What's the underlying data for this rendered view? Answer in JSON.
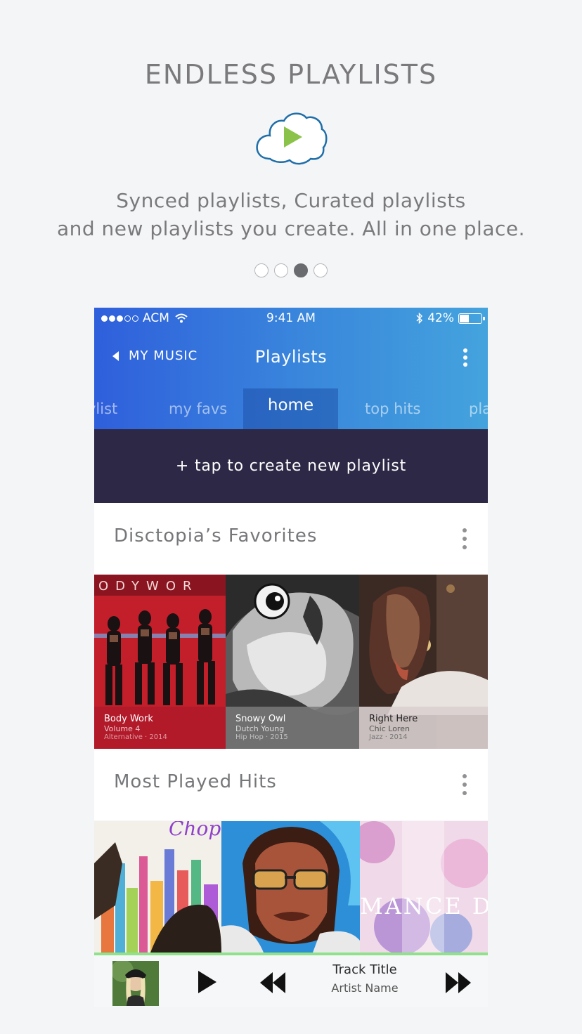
{
  "promo": {
    "title": "ENDLESS PLAYLISTS",
    "line1": "Synced playlists, Curated playlists",
    "line2": "and new playlists you create. All in one place.",
    "icon": "cloud-play-icon",
    "pagination": {
      "count": 4,
      "active_index": 3
    }
  },
  "status_bar": {
    "carrier": "ACM",
    "time": "9:41 AM",
    "battery": "42%",
    "battery_level": 0.42
  },
  "nav": {
    "back_label": "MY MUSIC",
    "title": "Playlists"
  },
  "tabs": [
    {
      "label": "ylist"
    },
    {
      "label": "my favs"
    },
    {
      "label": "home",
      "active": true
    },
    {
      "label": "top hits"
    },
    {
      "label": "pla"
    }
  ],
  "create_button": "+ tap to create new playlist",
  "sections": [
    {
      "title": "Disctopia’s Favorites",
      "items": [
        {
          "title": "Body Work",
          "artist": "Volume 4",
          "meta": "Alternative · 2014"
        },
        {
          "title": "Snowy Owl",
          "artist": "Dutch Young",
          "meta": "Hip Hop · 2015"
        },
        {
          "title": "Right Here",
          "artist": "Chic Loren",
          "meta": "Jazz · 2014"
        }
      ]
    },
    {
      "title": "Most Played Hits",
      "items": [
        {
          "cover_text": "Chopp"
        },
        {
          "cover_text": ""
        },
        {
          "cover_text": "MANCE DAW"
        }
      ]
    }
  ],
  "player": {
    "track_title": "Track Title",
    "artist_name": "Artist Name"
  },
  "colors": {
    "header_start": "#2f5fdc",
    "header_end": "#44a3dd",
    "create_bg": "#2d2845",
    "progress": "#8fe28a",
    "cloud_stroke": "#1f6ea8",
    "play_green": "#8bc34a"
  }
}
